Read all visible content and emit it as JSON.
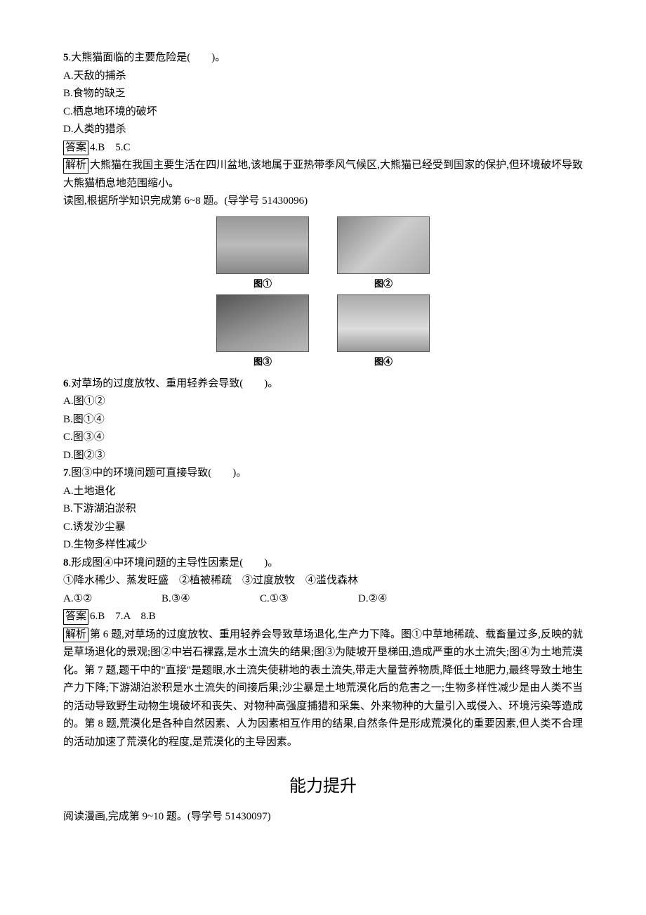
{
  "q5": {
    "stem_num": "5",
    "stem_text": ".大熊猫面临的主要危险是(　　)。",
    "opt_a": "A.天敌的捕杀",
    "opt_b": "B.食物的缺乏",
    "opt_c": "C.栖息地环境的破坏",
    "opt_d": "D.人类的猎杀"
  },
  "ans_4_5": {
    "label": "答案",
    "text": "4.B　5.C"
  },
  "exp_4_5": {
    "label": "解析",
    "text": "大熊猫在我国主要生活在四川盆地,该地属于亚热带季风气候区,大熊猫已经受到国家的保护,但环境破坏导致大熊猫栖息地范围缩小。"
  },
  "lead_6_8": "读图,根据所学知识完成第 6~8 题。(导学号 51430096)",
  "figcap": {
    "f1": "图①",
    "f2": "图②",
    "f3": "图③",
    "f4": "图④"
  },
  "q6": {
    "stem_num": "6",
    "stem_text": ".对草场的过度放牧、重用轻养会导致(　　)。",
    "opt_a": "A.图①②",
    "opt_b": "B.图①④",
    "opt_c": "C.图③④",
    "opt_d": "D.图②③"
  },
  "q7": {
    "stem_num": "7",
    "stem_text": ".图③中的环境问题可直接导致(　　)。",
    "opt_a": "A.土地退化",
    "opt_b": "B.下游湖泊淤积",
    "opt_c": "C.诱发沙尘暴",
    "opt_d": "D.生物多样性减少"
  },
  "q8": {
    "stem_num": "8",
    "stem_text": ".形成图④中环境问题的主导性因素是(　　)。",
    "factors": "①降水稀少、蒸发旺盛　②植被稀疏　③过度放牧　④滥伐森林",
    "opt_a": "A.①②",
    "opt_b": "B.③④",
    "opt_c": "C.①③",
    "opt_d": "D.②④"
  },
  "ans_6_8": {
    "label": "答案",
    "text": "6.B　7.A　8.B"
  },
  "exp_6_8": {
    "label": "解析",
    "text": "第 6 题,对草场的过度放牧、重用轻养会导致草场退化,生产力下降。图①中草地稀疏、载畜量过多,反映的就是草场退化的景观;图②中岩石裸露,是水土流失的结果;图③为陡坡开垦梯田,造成严重的水土流失;图④为土地荒漠化。第 7 题,题干中的\"直接\"是题眼,水土流失使耕地的表土流失,带走大量营养物质,降低土地肥力,最终导致土地生产力下降;下游湖泊淤积是水土流失的间接后果;沙尘暴是土地荒漠化后的危害之一;生物多样性减少是由人类不当的活动导致野生动物生境破坏和丧失、对物种高强度捕猎和采集、外来物种的大量引入或侵入、环境污染等造成的。第 8 题,荒漠化是各种自然因素、人为因素相互作用的结果,自然条件是形成荒漠化的重要因素,但人类不合理的活动加速了荒漠化的程度,是荒漠化的主导因素。"
  },
  "section_title": "能力提升",
  "lead_9_10": "阅读漫画,完成第 9~10 题。(导学号 51430097)"
}
